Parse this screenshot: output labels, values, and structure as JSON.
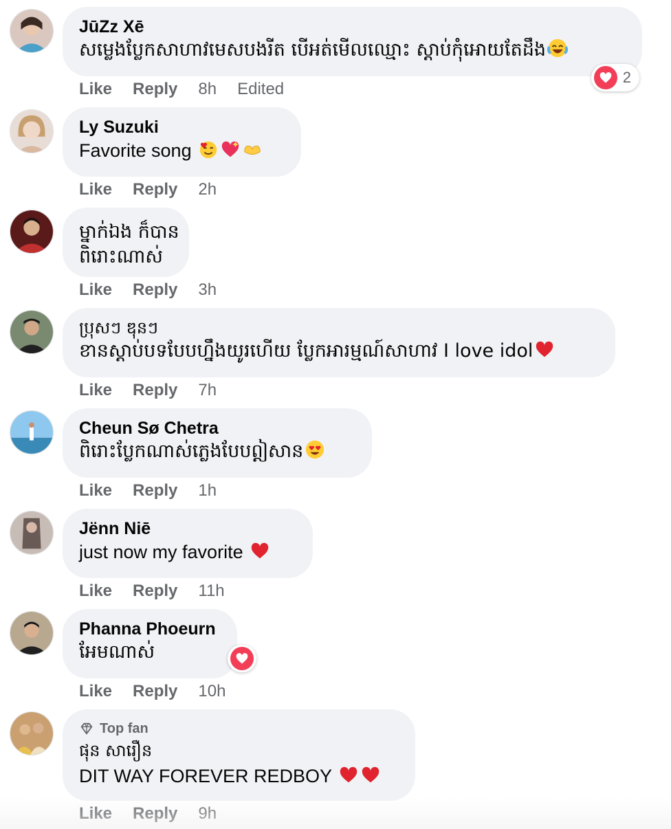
{
  "colors": {
    "bubble": "#f0f2f5",
    "meta_text": "#65676b",
    "love_reaction": "#f33e58",
    "heart_emoji": "#e0232f"
  },
  "comments": [
    {
      "author": "JūZz Xē",
      "lines": [
        "សម្លេងប្លែកសាហាវមេសបងរីត បើអត់មើលឈ្មោះ ស្ដាប់កុំអោយតែដឹង"
      ],
      "emoji": [
        "laughing-tears-emoji"
      ],
      "like": "Like",
      "reply": "Reply",
      "time": "8h",
      "edited": "Edited",
      "reaction": {
        "icon": "heart-reaction-icon",
        "count": "2"
      }
    },
    {
      "author": "Ly Suzuki",
      "lines": [
        "Favorite song"
      ],
      "emoji": [
        "smiling-hearts-emoji",
        "sparkling-heart-emoji",
        "heart-hands-emoji"
      ],
      "like": "Like",
      "reply": "Reply",
      "time": "2h"
    },
    {
      "author": "",
      "lines": [
        "ម្នាក់ឯង ក៏បាន",
        "ពិរោះណាស់"
      ],
      "like": "Like",
      "reply": "Reply",
      "time": "3h"
    },
    {
      "author": "ប្រុសៗ ឌុនៗ",
      "lines": [
        "ខានស្ដាប់បទបែបហ្នឹងយូរហើយ ប្លែកអារម្មណ៍សាហាវ I love idol"
      ],
      "emoji": [
        "red-heart-emoji"
      ],
      "like": "Like",
      "reply": "Reply",
      "time": "7h"
    },
    {
      "author": "Cheun Sø Chetra",
      "lines": [
        "ពិរោះប្លែកណាស់ភ្លេងបែបឦសាន"
      ],
      "emoji": [
        "heart-eyes-emoji"
      ],
      "like": "Like",
      "reply": "Reply",
      "time": "1h"
    },
    {
      "author": "Jënn Niē",
      "lines": [
        "just now my favorite"
      ],
      "emoji": [
        "red-heart-emoji"
      ],
      "like": "Like",
      "reply": "Reply",
      "time": "11h"
    },
    {
      "author": "Phanna Phoeurn",
      "lines": [
        "អែមណាស់"
      ],
      "like": "Like",
      "reply": "Reply",
      "time": "10h",
      "reaction": {
        "icon": "heart-reaction-icon",
        "count": ""
      }
    },
    {
      "badge": "Top fan",
      "author": "ផុន សារឿន",
      "lines": [
        "DIT WAY FOREVER REDBOY"
      ],
      "emoji": [
        "red-heart-emoji",
        "red-heart-emoji"
      ],
      "like": "Like",
      "reply": "Reply",
      "time": "9h"
    }
  ]
}
